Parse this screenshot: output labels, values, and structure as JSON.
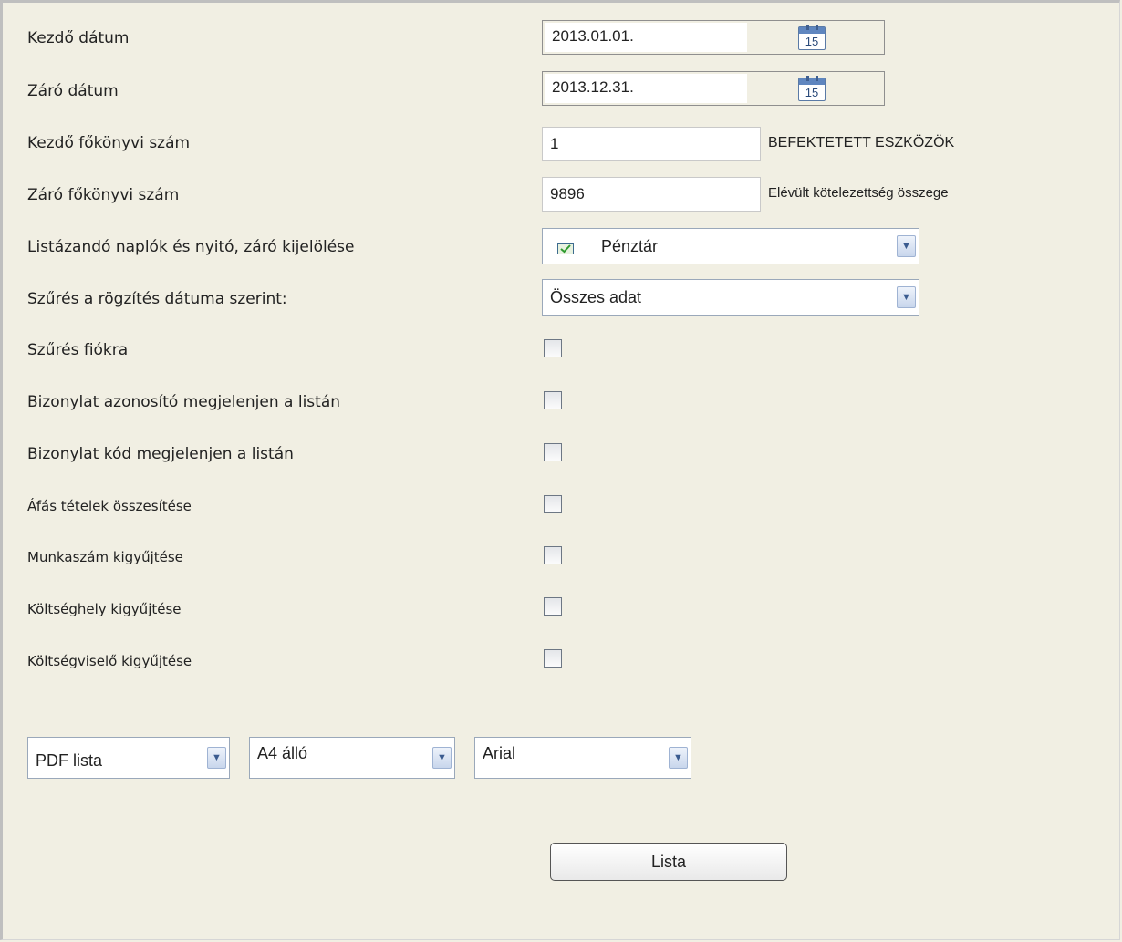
{
  "form": {
    "start_date": {
      "label": "Kezdő dátum",
      "value": "2013.01.01.",
      "calendar_icon_text": "15"
    },
    "end_date": {
      "label": "Záró dátum",
      "value": "2013.12.31.",
      "calendar_icon_text": "15"
    },
    "start_account": {
      "label": "Kezdő főkönyvi szám",
      "value": "1",
      "caption": "BEFEKTETETT ESZKÖZÖK"
    },
    "end_account": {
      "label": "Záró főkönyvi szám",
      "value": "9896",
      "caption": "Elévült kötelezettség összege"
    },
    "journals": {
      "label": "Listázandó naplók és nyitó, záró kijelölése",
      "value": "Pénztár",
      "icon": "checked-journal-icon"
    },
    "date_filter": {
      "label": "Szűrés a rögzítés dátuma szerint:",
      "value": "Összes adat"
    },
    "checkboxes": [
      {
        "label": "Szűrés fiókra",
        "checked": false
      },
      {
        "label": "Bizonylat azonosító megjelenjen a listán",
        "checked": false
      },
      {
        "label": "Bizonylat kód megjelenjen a listán",
        "checked": false
      },
      {
        "label": "Áfás tételek összesítése",
        "checked": false
      },
      {
        "label": "Munkaszám kigyűjtése",
        "checked": false
      },
      {
        "label": "Költséghely kigyűjtése",
        "checked": false
      },
      {
        "label": "Költségviselő kigyűjtése",
        "checked": false
      }
    ]
  },
  "output": {
    "format": "PDF lista",
    "paper": "A4 álló",
    "font": "Arial",
    "dropdown_icon": "chevron-down-icon"
  },
  "actions": {
    "list_button": "Lista"
  },
  "colors": {
    "background": "#f1efe3",
    "dropdown_arrow": "#3a5b8f",
    "checkbox_border": "#6d7784"
  }
}
